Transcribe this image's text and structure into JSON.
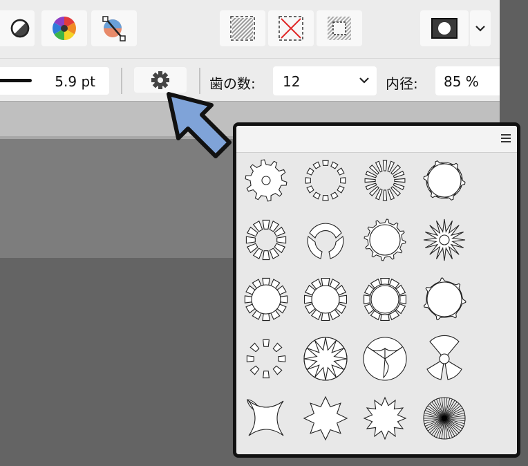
{
  "toolbar": {
    "buttons": [
      {
        "name": "contrast-icon"
      },
      {
        "name": "color-wheel-icon"
      },
      {
        "name": "vector-brush-icon"
      },
      {
        "name": "selection-fill-icon"
      },
      {
        "name": "selection-clear-icon"
      },
      {
        "name": "selection-invert-icon"
      },
      {
        "name": "record-icon"
      },
      {
        "name": "chevron-down-icon"
      }
    ]
  },
  "context": {
    "stroke_width": "5.9 pt",
    "teeth_label": "歯の数:",
    "teeth_value": "12",
    "inner_radius_label": "内径:",
    "inner_radius_value": "85 %"
  },
  "panel": {
    "menu_icon": "hamburger-menu-icon",
    "preset_count": 20,
    "columns": 4
  },
  "colors": {
    "toolbar_bg": "#ececec",
    "canvas": "#646464",
    "arrow_fill": "#7fa3d8",
    "panel_border": "#111111"
  }
}
